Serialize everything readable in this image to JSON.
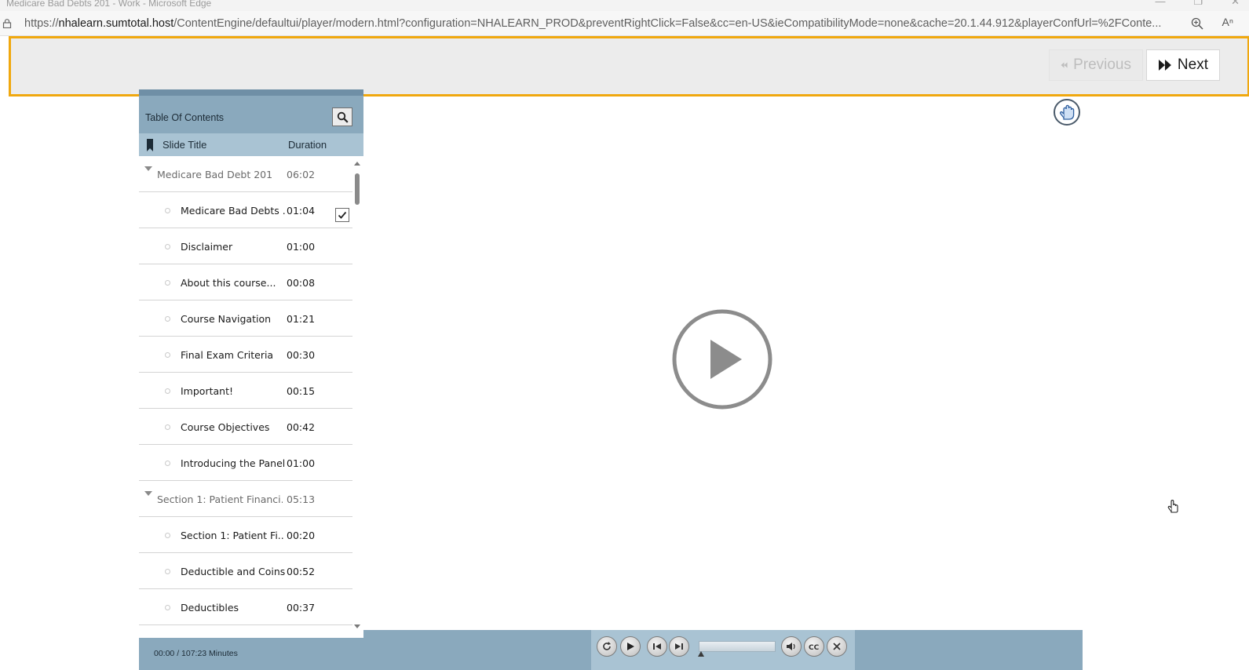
{
  "window": {
    "title": "Medicare Bad Debts 201 - Work - Microsoft Edge"
  },
  "address": {
    "prefix": "https://",
    "host": "nhalearn.sumtotal.host",
    "path": "/ContentEngine/defaultui/player/modern.html?configuration=NHALEARN_PROD&preventRightClick=False&cc=en-US&ieCompatibilityMode=none&cache=20.1.44.912&playerConfUrl=%2FConte..."
  },
  "toolbar": {
    "previous_label": "Previous",
    "next_label": "Next"
  },
  "toc": {
    "title": "Table Of Contents",
    "col_title": "Slide Title",
    "col_duration": "Duration",
    "items": [
      {
        "type": "section",
        "label": "Medicare Bad Debt 201",
        "duration": "06:02",
        "checked": false
      },
      {
        "type": "slide",
        "label": "Medicare Bad Debts ...",
        "duration": "01:04",
        "checked": true
      },
      {
        "type": "slide",
        "label": "Disclaimer",
        "duration": "01:00",
        "checked": false
      },
      {
        "type": "slide",
        "label": "About this course...",
        "duration": "00:08",
        "checked": false
      },
      {
        "type": "slide",
        "label": "Course Navigation",
        "duration": "01:21",
        "checked": false
      },
      {
        "type": "slide",
        "label": "Final Exam Criteria",
        "duration": "00:30",
        "checked": false
      },
      {
        "type": "slide",
        "label": "Important!",
        "duration": "00:15",
        "checked": false
      },
      {
        "type": "slide",
        "label": "Course Objectives",
        "duration": "00:42",
        "checked": false
      },
      {
        "type": "slide",
        "label": "Introducing the Panel",
        "duration": "01:00",
        "checked": false
      },
      {
        "type": "section",
        "label": "Section 1: Patient Financi...",
        "duration": "05:13",
        "checked": false
      },
      {
        "type": "slide",
        "label": "Section 1: Patient Fi...",
        "duration": "00:20",
        "checked": false
      },
      {
        "type": "slide",
        "label": "Deductible and Coins...",
        "duration": "00:52",
        "checked": false
      },
      {
        "type": "slide",
        "label": "Deductibles",
        "duration": "00:37",
        "checked": false
      },
      {
        "type": "slide",
        "label": "",
        "duration": "",
        "checked": false
      }
    ],
    "time": "00:00 / 107:23 Minutes"
  },
  "player": {
    "progress": 0,
    "controls": [
      "replay-icon",
      "play-icon",
      "skip-back-icon",
      "skip-forward-icon",
      "volume-icon",
      "closed-captions-icon",
      "close-icon"
    ]
  },
  "colors": {
    "highlight": "#f0a80f",
    "panel": "#8aa9bd",
    "panel_light": "#a9c3d3"
  }
}
